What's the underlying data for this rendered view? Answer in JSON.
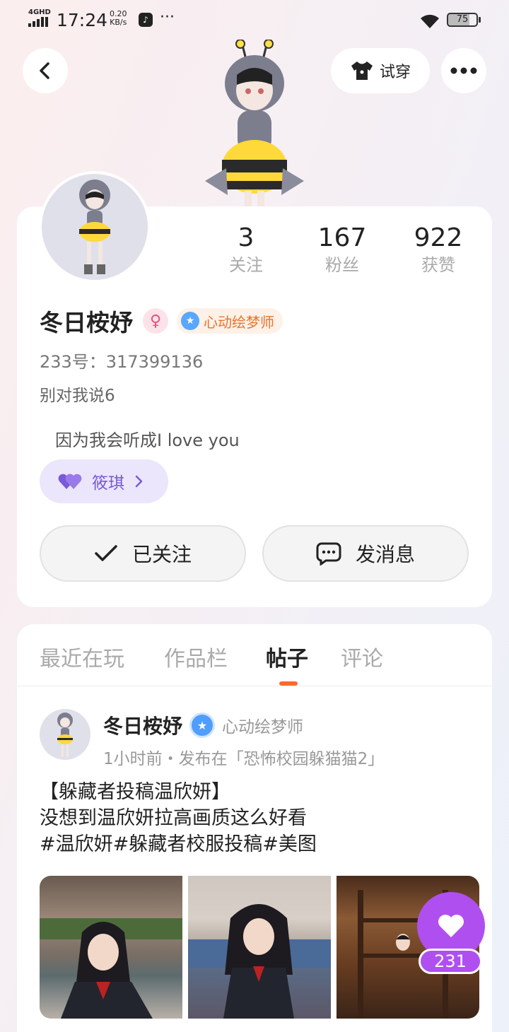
{
  "status_bar": {
    "network": "4GHD",
    "time": "17:24",
    "speed_value": "0.20",
    "speed_unit": "KB/s",
    "battery": "75"
  },
  "header": {
    "tryon_label": "试穿"
  },
  "profile": {
    "username": "冬日桉妤",
    "title_badge": "心动绘梦师",
    "id_line": "233号：317399136",
    "bio_line1": "别对我说6",
    "bio_line2": "因为我会听成I love you",
    "cp_name": "筱琪",
    "stats": [
      {
        "value": "3",
        "label": "关注"
      },
      {
        "value": "167",
        "label": "粉丝"
      },
      {
        "value": "922",
        "label": "获赞"
      }
    ],
    "follow_label": "已关注",
    "message_label": "发消息"
  },
  "tabs": [
    {
      "label": "最近在玩",
      "active": false
    },
    {
      "label": "作品栏",
      "active": false
    },
    {
      "label": "帖子",
      "active": true
    },
    {
      "label": "评论",
      "active": false
    }
  ],
  "post": {
    "author": "冬日桉妤",
    "author_title": "心动绘梦师",
    "meta": "1小时前・发布在「恐怖校园躲猫猫2」",
    "text_lines": [
      "【躲藏者投稿温欣妍】",
      "没想到温欣妍拉高画质这么好看",
      "#温欣妍#躲藏者校服投稿#美图"
    ],
    "like_count": "231"
  },
  "colors": {
    "accent_orange": "#ff6a2b",
    "like_purple": "#b04ff0",
    "cp_purple": "#7a5ad8",
    "title_orange": "#e8742c"
  }
}
